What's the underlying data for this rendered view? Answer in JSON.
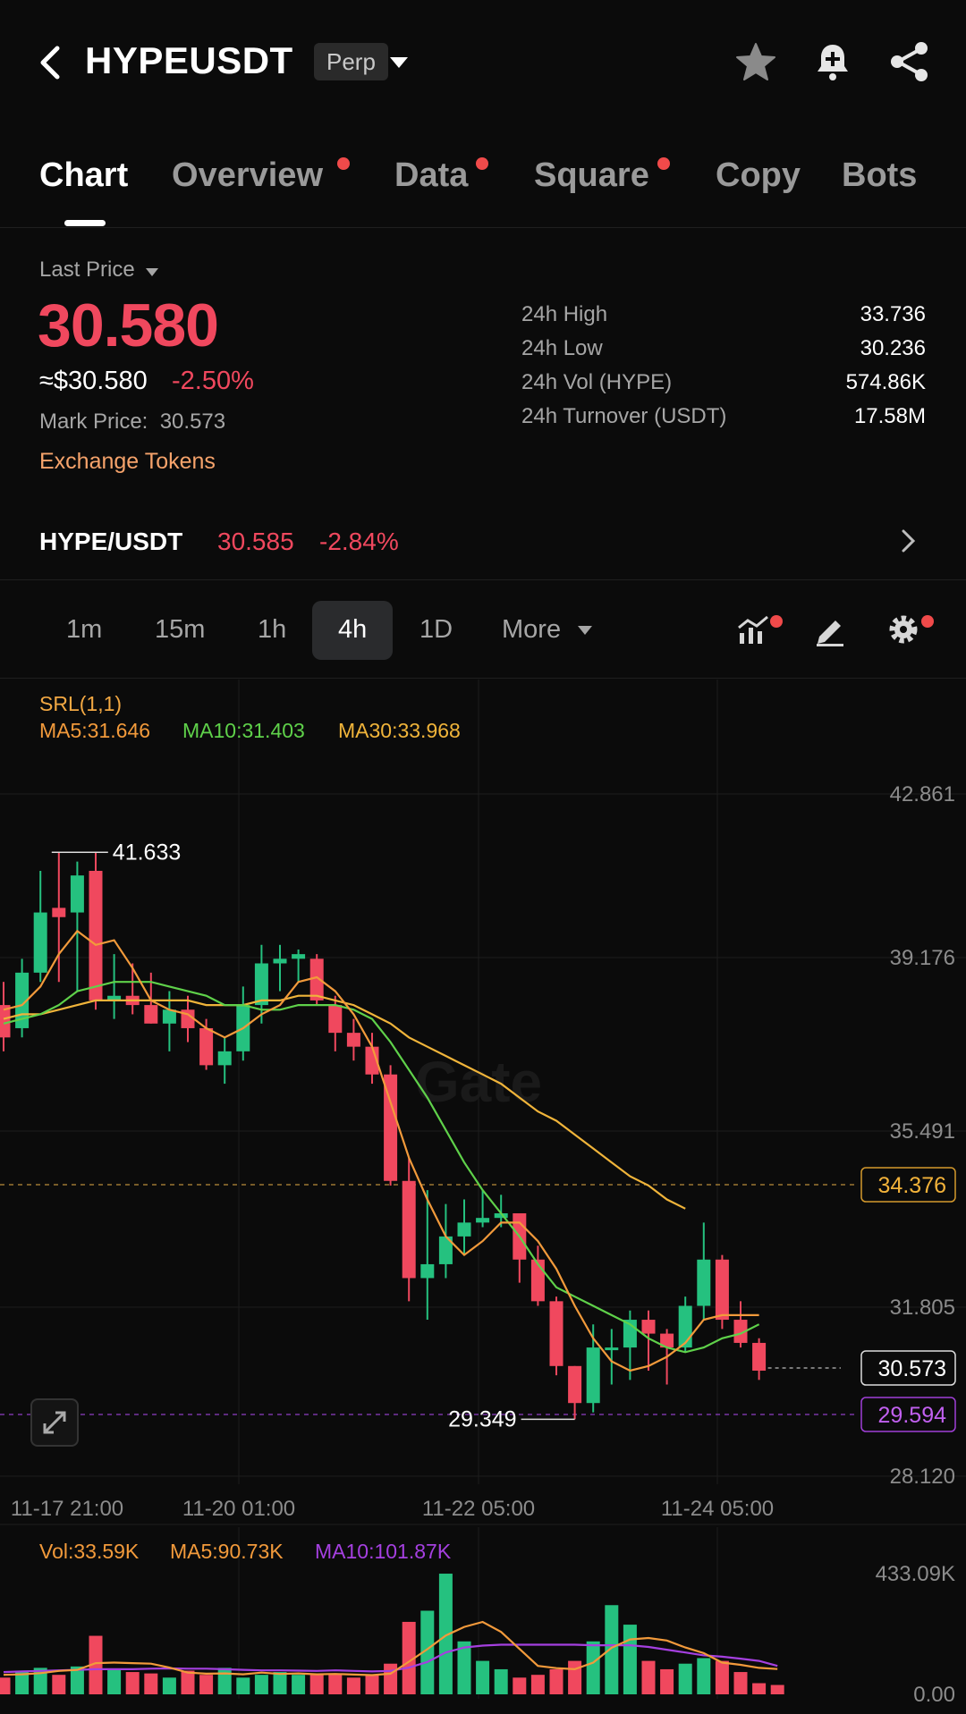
{
  "header": {
    "symbol": "HYPEUSDT",
    "market_type": "Perp",
    "icons": [
      "back-arrow-icon",
      "star-icon",
      "bell-plus-icon",
      "share-icon"
    ]
  },
  "tabs": [
    {
      "label": "Chart",
      "active": true,
      "dot": false
    },
    {
      "label": "Overview",
      "active": false,
      "dot": true
    },
    {
      "label": "Data",
      "active": false,
      "dot": true
    },
    {
      "label": "Square",
      "active": false,
      "dot": true
    },
    {
      "label": "Copy",
      "active": false,
      "dot": false
    },
    {
      "label": "Bots",
      "active": false,
      "dot": false
    }
  ],
  "price": {
    "label": "Last Price",
    "last": "30.580",
    "usd": "≈$30.580",
    "change": "-2.50%",
    "mark_label": "Mark Price:",
    "mark_value": "30.573",
    "exchange_tokens": "Exchange Tokens"
  },
  "stats": [
    {
      "label": "24h High",
      "value": "33.736"
    },
    {
      "label": "24h Low",
      "value": "30.236"
    },
    {
      "label": "24h Vol (HYPE)",
      "value": "574.86K"
    },
    {
      "label": "24h Turnover (USDT)",
      "value": "17.58M"
    }
  ],
  "spot_pair": {
    "name": "HYPE/USDT",
    "price": "30.585",
    "change": "-2.84%"
  },
  "intervals": {
    "options": [
      "1m",
      "15m",
      "1h",
      "4h",
      "1D"
    ],
    "active": "4h",
    "more_label": "More"
  },
  "colors": {
    "up": "#25c17f",
    "down": "#f0485e",
    "ma5": "#f29a3b",
    "ma10": "#5fd14a",
    "ma30": "#f0b43a",
    "vol_ma10": "#a540e0",
    "bg": "#0b0b0b"
  },
  "chart_data": {
    "type": "candlestick",
    "indicator_label": "SRL(1,1)",
    "ma_labels": {
      "ma5": "MA5:31.646",
      "ma10": "MA10:31.403",
      "ma30": "MA30:33.968"
    },
    "price_axis": [
      "42.861",
      "39.176",
      "35.491",
      "31.805",
      "28.120"
    ],
    "price_range": [
      28.12,
      42.861
    ],
    "time_axis": [
      "11-17 21:00",
      "11-20 01:00",
      "11-22 05:00",
      "11-24 05:00"
    ],
    "markers": {
      "high": "41.633",
      "low": "29.349",
      "ma30_line": "34.376",
      "current": "30.573",
      "support_line": "29.594"
    },
    "candles": [
      {
        "o": 38.3,
        "h": 38.8,
        "l": 37.3,
        "c": 37.6
      },
      {
        "o": 37.8,
        "h": 39.3,
        "l": 37.6,
        "c": 39.0
      },
      {
        "o": 39.0,
        "h": 41.2,
        "l": 38.8,
        "c": 40.3
      },
      {
        "o": 40.4,
        "h": 41.6,
        "l": 38.8,
        "c": 40.2
      },
      {
        "o": 40.3,
        "h": 41.4,
        "l": 38.6,
        "c": 41.1
      },
      {
        "o": 41.2,
        "h": 41.6,
        "l": 38.2,
        "c": 38.4
      },
      {
        "o": 38.4,
        "h": 39.4,
        "l": 38.0,
        "c": 38.5
      },
      {
        "o": 38.5,
        "h": 39.2,
        "l": 38.1,
        "c": 38.3
      },
      {
        "o": 38.3,
        "h": 39.0,
        "l": 37.9,
        "c": 37.9
      },
      {
        "o": 37.9,
        "h": 38.6,
        "l": 37.3,
        "c": 38.2
      },
      {
        "o": 38.2,
        "h": 38.5,
        "l": 37.5,
        "c": 37.8
      },
      {
        "o": 37.8,
        "h": 38.0,
        "l": 36.9,
        "c": 37.0
      },
      {
        "o": 37.0,
        "h": 37.6,
        "l": 36.6,
        "c": 37.3
      },
      {
        "o": 37.3,
        "h": 38.7,
        "l": 37.1,
        "c": 38.3
      },
      {
        "o": 38.3,
        "h": 39.6,
        "l": 37.9,
        "c": 39.2
      },
      {
        "o": 39.2,
        "h": 39.6,
        "l": 38.6,
        "c": 39.3
      },
      {
        "o": 39.3,
        "h": 39.5,
        "l": 38.8,
        "c": 39.4
      },
      {
        "o": 39.3,
        "h": 39.4,
        "l": 38.3,
        "c": 38.4
      },
      {
        "o": 38.3,
        "h": 38.5,
        "l": 37.3,
        "c": 37.7
      },
      {
        "o": 37.7,
        "h": 38.0,
        "l": 37.1,
        "c": 37.4
      },
      {
        "o": 37.4,
        "h": 37.7,
        "l": 36.6,
        "c": 36.8
      },
      {
        "o": 36.8,
        "h": 37.0,
        "l": 34.4,
        "c": 34.5
      },
      {
        "o": 34.5,
        "h": 35.0,
        "l": 31.9,
        "c": 32.4
      },
      {
        "o": 32.4,
        "h": 34.3,
        "l": 31.5,
        "c": 32.7
      },
      {
        "o": 32.7,
        "h": 34.0,
        "l": 32.4,
        "c": 33.3
      },
      {
        "o": 33.3,
        "h": 34.1,
        "l": 32.9,
        "c": 33.6
      },
      {
        "o": 33.6,
        "h": 34.3,
        "l": 33.5,
        "c": 33.7
      },
      {
        "o": 33.7,
        "h": 34.2,
        "l": 33.5,
        "c": 33.8
      },
      {
        "o": 33.8,
        "h": 33.8,
        "l": 32.3,
        "c": 32.8
      },
      {
        "o": 32.8,
        "h": 33.1,
        "l": 31.8,
        "c": 31.9
      },
      {
        "o": 31.9,
        "h": 32.0,
        "l": 30.3,
        "c": 30.5
      },
      {
        "o": 30.5,
        "h": 30.5,
        "l": 29.35,
        "c": 29.7
      },
      {
        "o": 29.7,
        "h": 31.4,
        "l": 29.5,
        "c": 30.9
      },
      {
        "o": 30.9,
        "h": 31.3,
        "l": 30.1,
        "c": 30.9
      },
      {
        "o": 30.9,
        "h": 31.7,
        "l": 30.2,
        "c": 31.5
      },
      {
        "o": 31.5,
        "h": 31.7,
        "l": 30.4,
        "c": 31.2
      },
      {
        "o": 31.2,
        "h": 31.3,
        "l": 30.1,
        "c": 30.9
      },
      {
        "o": 30.9,
        "h": 32.0,
        "l": 30.8,
        "c": 31.8
      },
      {
        "o": 31.8,
        "h": 33.6,
        "l": 31.5,
        "c": 32.8
      },
      {
        "o": 32.8,
        "h": 32.9,
        "l": 31.3,
        "c": 31.5
      },
      {
        "o": 31.5,
        "h": 31.9,
        "l": 30.9,
        "c": 31.0
      },
      {
        "o": 31.0,
        "h": 31.1,
        "l": 30.2,
        "c": 30.4
      }
    ],
    "ma5": [
      38.2,
      38.3,
      38.7,
      39.4,
      39.9,
      39.6,
      39.7,
      39.1,
      38.4,
      38.2,
      38.1,
      37.8,
      37.6,
      37.8,
      38.1,
      38.3,
      38.8,
      38.9,
      38.6,
      38.1,
      37.4,
      36.2,
      35.0,
      34.1,
      33.3,
      32.9,
      33.2,
      33.6,
      33.6,
      33.2,
      32.6,
      31.8,
      31.1,
      30.6,
      30.4,
      30.5,
      30.7,
      31.0,
      31.5,
      31.6,
      31.6,
      31.6
    ],
    "ma10": [
      37.9,
      38.0,
      38.1,
      38.3,
      38.6,
      38.7,
      38.8,
      38.8,
      38.8,
      38.7,
      38.6,
      38.5,
      38.3,
      38.3,
      38.2,
      38.2,
      38.3,
      38.3,
      38.3,
      38.2,
      38.0,
      37.5,
      36.9,
      36.3,
      35.6,
      34.9,
      34.3,
      33.8,
      33.3,
      32.7,
      32.2,
      32.0,
      31.8,
      31.6,
      31.4,
      31.1,
      30.9,
      30.8,
      30.9,
      31.1,
      31.2,
      31.4
    ],
    "ma30": [
      38.0,
      38.1,
      38.1,
      38.2,
      38.3,
      38.4,
      38.4,
      38.4,
      38.4,
      38.4,
      38.4,
      38.3,
      38.3,
      38.3,
      38.4,
      38.4,
      38.5,
      38.5,
      38.4,
      38.3,
      38.1,
      37.9,
      37.6,
      37.4,
      37.2,
      37.0,
      36.8,
      36.6,
      36.3,
      36.0,
      35.8,
      35.5,
      35.2,
      34.9,
      34.6,
      34.4,
      34.1,
      33.9
    ],
    "volume": {
      "label_vol": "Vol:33.59K",
      "label_ma5": "MA5:90.73K",
      "label_ma10": "MA10:101.87K",
      "axis": [
        "433.09K",
        "0.00"
      ],
      "max": 433.09,
      "values": [
        60,
        80,
        95,
        70,
        100,
        210,
        90,
        80,
        75,
        60,
        85,
        70,
        95,
        60,
        70,
        80,
        70,
        70,
        75,
        60,
        70,
        110,
        260,
        300,
        433,
        190,
        120,
        90,
        60,
        70,
        90,
        120,
        190,
        320,
        250,
        120,
        90,
        110,
        130,
        120,
        80,
        40,
        33.59
      ],
      "ma5": [
        70,
        72,
        76,
        84,
        88,
        112,
        114,
        112,
        110,
        96,
        78,
        74,
        75,
        72,
        78,
        73,
        75,
        72,
        73,
        71,
        69,
        74,
        117,
        162,
        211,
        242,
        260,
        224,
        163,
        102,
        94,
        90,
        114,
        167,
        197,
        202,
        193,
        168,
        148,
        114,
        106,
        95,
        90.73
      ],
      "ma10": [
        80,
        82,
        84,
        86,
        88,
        90,
        90,
        90,
        92,
        93,
        92,
        92,
        90,
        88,
        86,
        86,
        85,
        84,
        86,
        84,
        82,
        84,
        96,
        116,
        150,
        168,
        175,
        178,
        178,
        178,
        178,
        178,
        176,
        176,
        176,
        170,
        160,
        150,
        140,
        135,
        128,
        120,
        101.87
      ]
    }
  },
  "watermark": "Gate"
}
